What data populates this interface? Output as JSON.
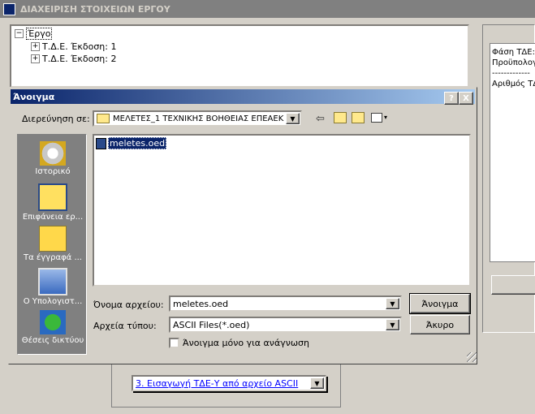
{
  "app": {
    "window_title": "ΔΙΑΧΕΙΡΙΣΗ ΣΤΟΙΧΕΙΩΝ ΕΡΓΟΥ"
  },
  "tree": {
    "root": "Έργο",
    "children": [
      "Τ.Δ.Ε. Έκδοση: 1",
      "Τ.Δ.Ε. Έκδοση: 2"
    ]
  },
  "right_panel": {
    "line1": "Φάση ΤΔΕ:",
    "line2": "Προϋπολογ",
    "line3": "-------------",
    "line4": "Αριθμός ΤΔ"
  },
  "dialog": {
    "title": "Άνοιγμα",
    "help_button": "?",
    "close_button": "X",
    "look_in_label": "Διερεύνηση σε:",
    "look_in_value": "ΜΕΛΕΤΕΣ_1 ΤΕΧΝΙΚΗΣ ΒΟΗΘΕΙΑΣ ΕΠΕΑΕΚ",
    "places": [
      "Ιστορικό",
      "Επιφάνεια ερ...",
      "Τα έγγραφά ...",
      "Ο Υπολογιστ...",
      "Θέσεις δικτύου"
    ],
    "files": [
      "meletes.oed"
    ],
    "filename_label": "Όνομα αρχείου:",
    "filename_value": "meletes.oed",
    "filetype_label": "Αρχεία τύπου:",
    "filetype_value": "ASCII Files(*.oed)",
    "readonly_label": "Άνοιγμα μόνο για ανάγνωση",
    "open_button": "Άνοιγμα",
    "cancel_button": "Άκυρο"
  },
  "bottom": {
    "combo_value": "3. Εισαγωγή ΤΔΕ-Υ από αρχείο ASCII"
  },
  "colors": {
    "face": "#d4d0c8",
    "title_active": "#0a246a",
    "title_inactive": "#808080",
    "link": "#0000ff"
  }
}
